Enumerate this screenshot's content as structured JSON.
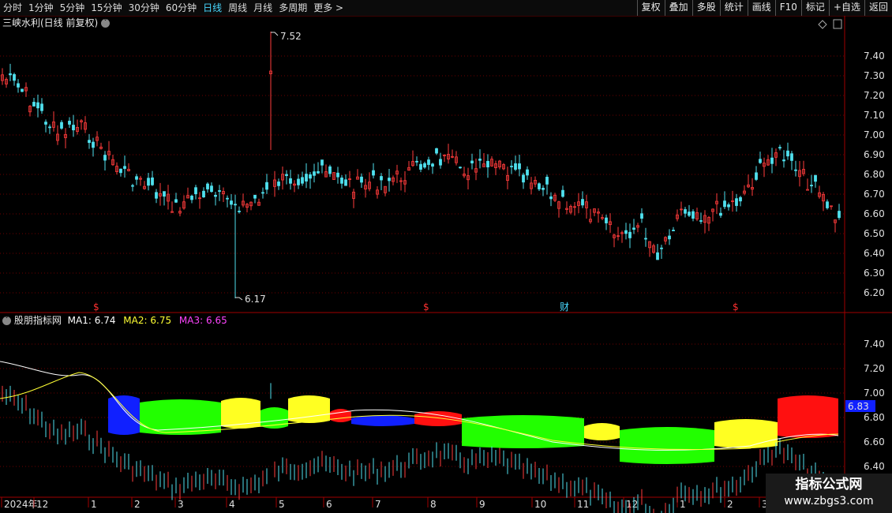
{
  "toolbar": {
    "tabs": [
      "分时",
      "1分钟",
      "5分钟",
      "15分钟",
      "30分钟",
      "60分钟",
      "日线",
      "周线",
      "月线",
      "多周期",
      "更多 >"
    ],
    "active_tab": "日线",
    "right_buttons": [
      "复权",
      "叠加",
      "多股",
      "统计",
      "画线",
      "F10",
      "标记",
      "+自选",
      "返回"
    ]
  },
  "main_chart": {
    "title": "三峡水利(日线 前复权)",
    "high_label": "7.52",
    "low_label": "6.17",
    "y_ticks": [
      "7.40",
      "7.30",
      "7.20",
      "7.10",
      "7.00",
      "6.90",
      "6.80",
      "6.70",
      "6.60",
      "6.50",
      "6.40",
      "6.30",
      "6.20"
    ],
    "markers": [
      "$",
      "$",
      "财",
      "$"
    ]
  },
  "indicator": {
    "name": "股朋指标网",
    "ma1_label": "MA1:",
    "ma1_value": "6.74",
    "ma2_label": "MA2:",
    "ma2_value": "6.75",
    "ma3_label": "MA3:",
    "ma3_value": "6.65",
    "y_ticks": [
      "7.40",
      "7.20",
      "7.00",
      "6.80",
      "6.60",
      "6.40"
    ],
    "current_value": "6.83"
  },
  "x_axis": {
    "labels": [
      "2024年",
      "12",
      "1",
      "2",
      "3",
      "4",
      "5",
      "6",
      "7",
      "8",
      "9",
      "10",
      "11",
      "12",
      "1",
      "2",
      "3"
    ]
  },
  "colors": {
    "up": "#ff3b3b",
    "down": "#4fe0ee",
    "grid": "#6b0000",
    "ma1": "#ffffff",
    "ma2": "#ffff33",
    "ma3": "#ff44ff",
    "band_blue": "#1020ff",
    "band_green": "#22ff00",
    "band_yellow": "#ffff22",
    "band_red": "#ff1010"
  },
  "watermark": {
    "line1": "指标公式网",
    "line2": "www.zbgs3.com"
  }
}
